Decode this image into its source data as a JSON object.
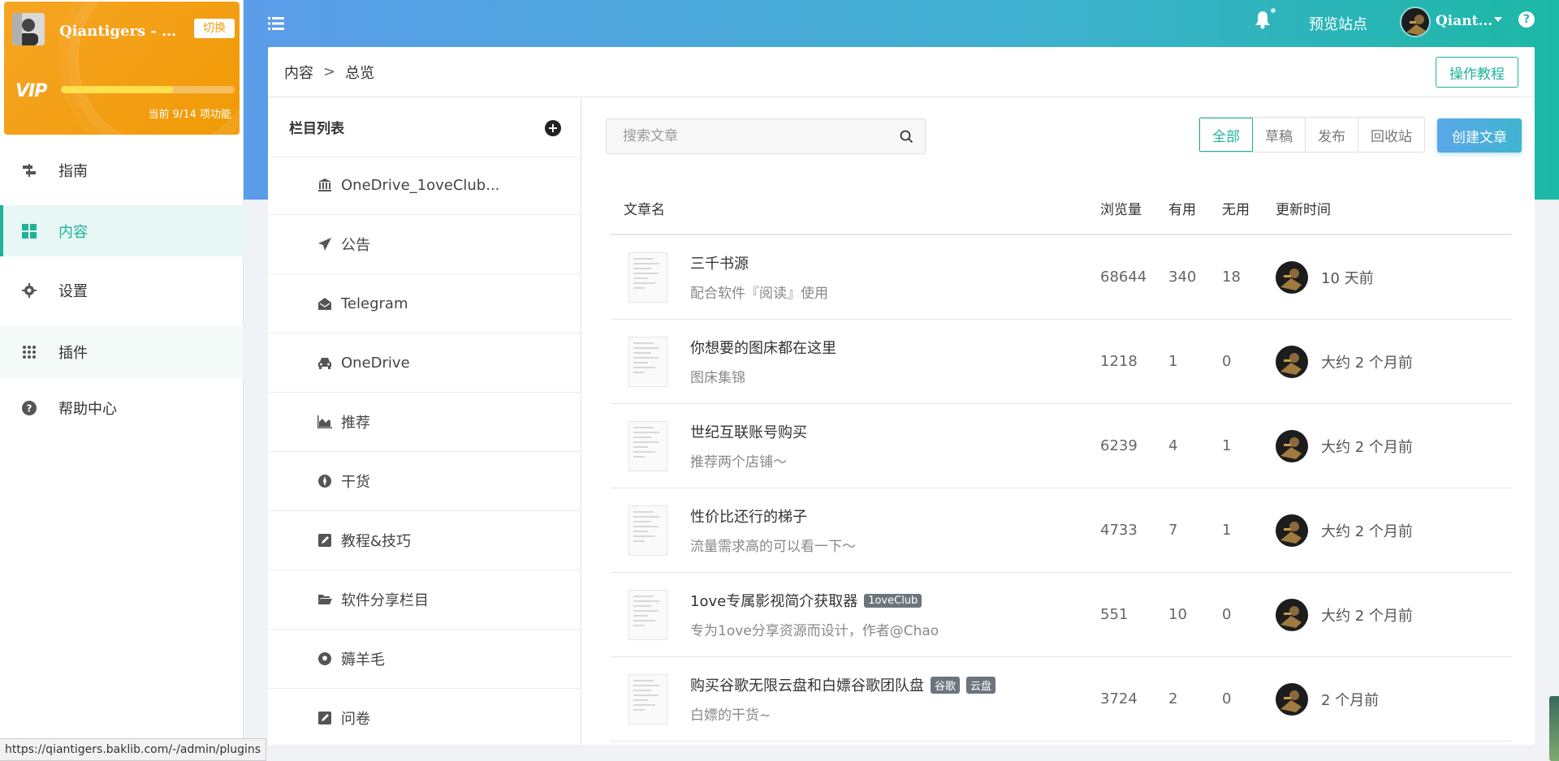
{
  "account": {
    "name": "Qiantigers - 勿...",
    "switch_label": "切换",
    "vip_label": "VIP",
    "feature_text": "当前 9/14 项功能",
    "features_used": 9,
    "features_total": 14
  },
  "nav": [
    {
      "label": "指南",
      "icon": "signpost-icon"
    },
    {
      "label": "内容",
      "icon": "grid-icon"
    },
    {
      "label": "设置",
      "icon": "gear-icon"
    },
    {
      "label": "插件",
      "icon": "dots-grid-icon"
    },
    {
      "label": "帮助中心",
      "icon": "question-circle-icon"
    }
  ],
  "topbar": {
    "preview_label": "预览站点",
    "user_name": "Qiant...",
    "help_label": "?"
  },
  "breadcrumb": {
    "parent": "内容",
    "separator": ">",
    "current": "总览"
  },
  "tutorial_label": "操作教程",
  "columns": {
    "title": "栏目列表",
    "add_label": "+",
    "items": [
      {
        "label": "OneDrive_1oveClub...",
        "icon": "bank-icon"
      },
      {
        "label": "公告",
        "icon": "paper-plane-icon"
      },
      {
        "label": "Telegram",
        "icon": "envelope-open-icon"
      },
      {
        "label": "OneDrive",
        "icon": "car-icon"
      },
      {
        "label": "推荐",
        "icon": "area-chart-icon"
      },
      {
        "label": "干货",
        "icon": "rebel-icon"
      },
      {
        "label": "教程&技巧",
        "icon": "edit-icon"
      },
      {
        "label": "软件分享栏目",
        "icon": "folder-open-icon"
      },
      {
        "label": "薅羊毛",
        "icon": "soccer-ball-icon"
      },
      {
        "label": "问卷",
        "icon": "edit-icon"
      }
    ]
  },
  "search": {
    "placeholder": "搜索文章"
  },
  "filters": [
    "全部",
    "草稿",
    "发布",
    "回收站"
  ],
  "create_label": "创建文章",
  "table": {
    "headers": {
      "name": "文章名",
      "views": "浏览量",
      "useful": "有用",
      "useless": "无用",
      "time": "更新时间"
    },
    "rows": [
      {
        "title": "三千书源",
        "tags": [],
        "sub": "配合软件『阅读』使用",
        "views": "68644",
        "useful": "340",
        "useless": "18",
        "time": "10 天前"
      },
      {
        "title": "你想要的图床都在这里",
        "tags": [],
        "sub": "图床集锦",
        "views": "1218",
        "useful": "1",
        "useless": "0",
        "time": "大约 2 个月前"
      },
      {
        "title": "世纪互联账号购买",
        "tags": [],
        "sub": "推荐两个店铺～",
        "views": "6239",
        "useful": "4",
        "useless": "1",
        "time": "大约 2 个月前"
      },
      {
        "title": "性价比还行的梯子",
        "tags": [],
        "sub": "流量需求高的可以看一下～",
        "views": "4733",
        "useful": "7",
        "useless": "1",
        "time": "大约 2 个月前"
      },
      {
        "title": "1ove专属影视简介获取器",
        "tags": [
          "1oveClub"
        ],
        "sub": "专为1ove分享资源而设计，作者@Chao",
        "views": "551",
        "useful": "10",
        "useless": "0",
        "time": "大约 2 个月前"
      },
      {
        "title": "购买谷歌无限云盘和白嫖谷歌团队盘",
        "tags": [
          "谷歌",
          "云盘"
        ],
        "sub": "白嫖的干货~",
        "views": "3724",
        "useful": "2",
        "useless": "0",
        "time": "2 个月前"
      }
    ]
  },
  "status_url": "https://qiantigers.baklib.com/-/admin/plugins",
  "colors": {
    "accent": "#1fb39a",
    "vip": "#f4a017",
    "header_start": "#5b9ce9",
    "header_end": "#1cb8a6"
  }
}
